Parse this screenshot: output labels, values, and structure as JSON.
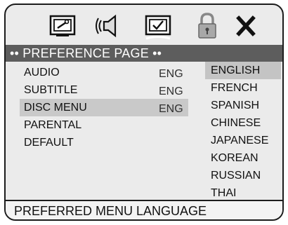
{
  "toolbar": {
    "icons": [
      "setup-icon",
      "speaker-icon",
      "preference-check-icon",
      "lock-icon",
      "close-x-icon"
    ],
    "active_icon": "preference-check-icon"
  },
  "header": {
    "title": "•• PREFERENCE PAGE ••"
  },
  "menu": {
    "items": [
      {
        "label": "AUDIO",
        "value": "ENG"
      },
      {
        "label": "SUBTITLE",
        "value": "ENG"
      },
      {
        "label": "DISC MENU",
        "value": "ENG"
      },
      {
        "label": "PARENTAL",
        "value": ""
      },
      {
        "label": "DEFAULT",
        "value": ""
      }
    ],
    "selected_index": 2
  },
  "options": {
    "items": [
      "ENGLISH",
      "FRENCH",
      "SPANISH",
      "CHINESE",
      "JAPANESE",
      "KOREAN",
      "RUSSIAN",
      "THAI"
    ],
    "selected_index": 0
  },
  "footer": {
    "status": "PREFERRED MENU LANGUAGE"
  },
  "colors": {
    "panel_bg": "#ebebeb",
    "header_bg": "#5d5d5d",
    "highlight": "#c9c9c9",
    "border": "#1c1c1c"
  }
}
